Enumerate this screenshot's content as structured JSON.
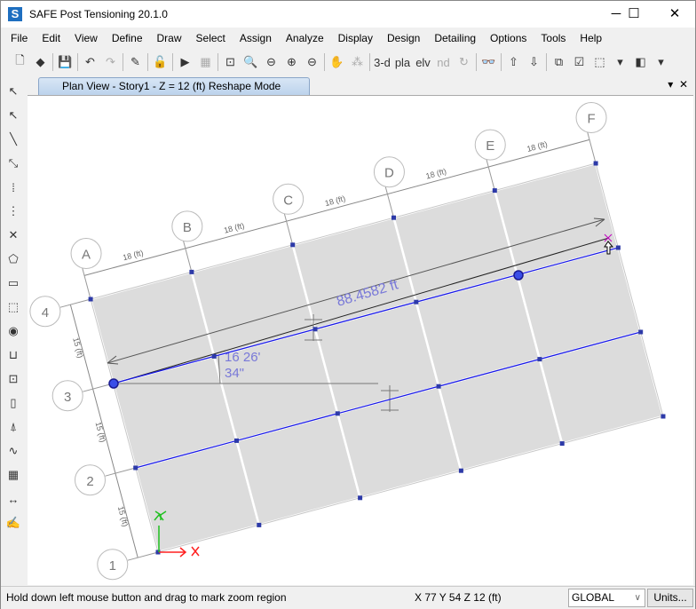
{
  "window": {
    "title": "SAFE Post Tensioning 20.1.0",
    "app_icon": "S",
    "minimize": "─",
    "maximize": "☐",
    "close": "✕"
  },
  "menu": [
    "File",
    "Edit",
    "View",
    "Define",
    "Draw",
    "Select",
    "Assign",
    "Analyze",
    "Display",
    "Design",
    "Detailing",
    "Options",
    "Tools",
    "Help"
  ],
  "toolbar": [
    {
      "name": "new-file-icon",
      "g": "🗋"
    },
    {
      "name": "open-file-icon",
      "g": "◆"
    },
    {
      "sep": true
    },
    {
      "name": "save-icon",
      "g": "💾"
    },
    {
      "sep": true
    },
    {
      "name": "undo-icon",
      "g": "↶"
    },
    {
      "name": "redo-icon",
      "g": "↷",
      "dim": true
    },
    {
      "sep": true
    },
    {
      "name": "pencil-icon",
      "g": "✎"
    },
    {
      "sep": true
    },
    {
      "name": "lock-icon",
      "g": "🔓"
    },
    {
      "sep": true
    },
    {
      "name": "run-analysis-icon",
      "g": "▶"
    },
    {
      "name": "lock-model-icon",
      "g": "▦",
      "dim": true
    },
    {
      "sep": true
    },
    {
      "name": "zoom-window-icon",
      "g": "⊡"
    },
    {
      "name": "zoom-full-icon",
      "g": "🔍"
    },
    {
      "name": "zoom-previous-icon",
      "g": "⊖"
    },
    {
      "name": "zoom-in-icon",
      "g": "⊕"
    },
    {
      "name": "zoom-out-icon",
      "g": "⊖"
    },
    {
      "sep": true
    },
    {
      "name": "pan-icon",
      "g": "✋"
    },
    {
      "name": "walk-icon",
      "g": "⁂",
      "dim": true
    },
    {
      "sep": true
    },
    {
      "name": "view-3d-icon",
      "g": "3-d"
    },
    {
      "name": "view-plan-icon",
      "g": "pla"
    },
    {
      "name": "view-elev-icon",
      "g": "elv"
    },
    {
      "name": "view-nd-icon",
      "g": "nd",
      "dim": true
    },
    {
      "name": "rotate-icon",
      "g": "↻",
      "dim": true
    },
    {
      "sep": true
    },
    {
      "name": "glasses-icon",
      "g": "👓"
    },
    {
      "sep": true
    },
    {
      "name": "move-up-icon",
      "g": "⇧"
    },
    {
      "name": "move-down-icon",
      "g": "⇩"
    },
    {
      "sep": true
    },
    {
      "name": "object-shrink-icon",
      "g": "⧉"
    },
    {
      "name": "set-display-options-icon",
      "g": "☑"
    },
    {
      "name": "extrude-icon",
      "g": "⬚"
    },
    {
      "name": "dropdown-icon",
      "g": "▾"
    },
    {
      "name": "shading-icon",
      "g": "◧"
    },
    {
      "name": "dropdown-icon",
      "g": "▾"
    }
  ],
  "left_toolbar": [
    {
      "name": "select-pointer-icon",
      "g": "↖"
    },
    {
      "name": "reshape-icon",
      "g": "↖"
    },
    {
      "name": "draw-line-icon",
      "g": "╲"
    },
    {
      "name": "draw-beam-icon",
      "g": "⤡"
    },
    {
      "name": "draw-column-icon",
      "g": "⁞"
    },
    {
      "name": "draw-wall-icon",
      "g": "⋮"
    },
    {
      "name": "draw-brace-icon",
      "g": "✕"
    },
    {
      "name": "draw-polygon-area-icon",
      "g": "⬠"
    },
    {
      "name": "draw-rectangle-area-icon",
      "g": "▭"
    },
    {
      "name": "quick-area-icon",
      "g": "⬚"
    },
    {
      "name": "draw-point-icon",
      "g": "◉"
    },
    {
      "name": "draw-opening-icon",
      "g": "⊔"
    },
    {
      "name": "draw-drop-panel-icon",
      "g": "⊡"
    },
    {
      "name": "draw-column-cap-icon",
      "g": "▯"
    },
    {
      "name": "draw-tendon-icon",
      "g": "⍋"
    },
    {
      "name": "draw-tendon-profile-icon",
      "g": "∿"
    },
    {
      "name": "draw-rebar-icon",
      "g": "▦"
    },
    {
      "name": "draw-dimension-icon",
      "g": "↔"
    },
    {
      "name": "draw-design-strip-icon",
      "g": "✍"
    }
  ],
  "tab": {
    "label": "Plan View - Story1 - Z = 12 (ft)  Reshape Mode",
    "menu": "▾",
    "close": "✕"
  },
  "plan": {
    "grid_x_labels": [
      "A",
      "B",
      "C",
      "D",
      "E",
      "F"
    ],
    "grid_y_labels": [
      "1",
      "2",
      "3",
      "4"
    ],
    "bay_x": "18 (ft)",
    "bay_y": "15 (ft)",
    "measure_length": "88.4582 ft",
    "measure_angle_1": "16 26'",
    "measure_angle_2": "34\"",
    "colors": {
      "slab": "#dcdcdc",
      "tendon": "#1a1ae6",
      "node": "#2d3aa8",
      "measure": "#7878d8",
      "axis_x": "#ff2020",
      "axis_y": "#20c020"
    }
  },
  "status": {
    "message": "Hold down left mouse button and drag to mark zoom region",
    "coords": "X 77  Y 54  Z 12 (ft)",
    "coord_system": "GLOBAL",
    "units_button": "Units..."
  }
}
